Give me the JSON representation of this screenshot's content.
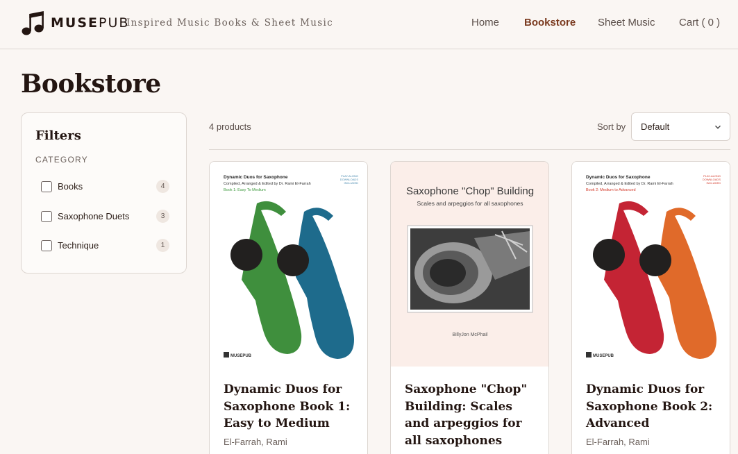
{
  "header": {
    "brand_main": "MUSE",
    "brand_sub": "PUB",
    "tagline": "Inspired Music Books & Sheet Music",
    "nav": [
      {
        "label": "Home",
        "active": false
      },
      {
        "label": "Bookstore",
        "active": true
      },
      {
        "label": "Sheet Music",
        "active": false
      },
      {
        "label": "Cart ( 0 )",
        "active": false
      }
    ]
  },
  "page": {
    "title": "Bookstore"
  },
  "filters": {
    "title": "Filters",
    "category_heading": "CATEGORY",
    "items": [
      {
        "label": "Books",
        "count": "4",
        "checked": false
      },
      {
        "label": "Saxophone Duets",
        "count": "3",
        "checked": false
      },
      {
        "label": "Technique",
        "count": "1",
        "checked": false
      }
    ]
  },
  "toolbar": {
    "product_count": "4 products",
    "sort_label": "Sort by",
    "sort_value": "Default"
  },
  "products": [
    {
      "title": "Dynamic Duos for Saxophone Book 1: Easy to Medium",
      "author": "El-Farrah, Rami",
      "cover": {
        "series": "Dynamic Duos for Saxophone",
        "credit": "Compiled, Arranged & Edited by Dr. Rami El-Farrah",
        "level": "Book 1: Easy To Medium",
        "badge": [
          "PLAY-ALONG",
          "DOWNLOADS",
          "INCLUDED"
        ],
        "publisher": "MUSEPUB",
        "color_left": "#3f8f3d",
        "color_right": "#1e6b8c",
        "level_color": "#3f9a3f"
      }
    },
    {
      "title": "Saxophone \"Chop\" Building: Scales and arpeggios for all saxophones",
      "author": "",
      "cover": {
        "heading": "Saxophone \"Chop\" Building",
        "subheading": "Scales and arpeggios for all saxophones",
        "author": "BillyJon McPhail",
        "background": "#fbeee9"
      }
    },
    {
      "title": "Dynamic Duos for Saxophone Book 2: Advanced",
      "author": "El-Farrah, Rami",
      "cover": {
        "series": "Dynamic Duos for Saxophone",
        "credit": "Compiled, Arranged & Edited by Dr. Rami El-Farrah",
        "level": "Book 2: Medium to Advanced",
        "badge": [
          "PLAY-ALONG",
          "DOWNLOADS",
          "INCLUDED"
        ],
        "publisher": "MUSEPUB",
        "color_left": "#c42434",
        "color_right": "#e06a2a",
        "level_color": "#d33a2a"
      }
    }
  ],
  "colors": {
    "accent": "#7a3a1f",
    "background": "#faf6f3",
    "border": "#ddd6d1"
  }
}
